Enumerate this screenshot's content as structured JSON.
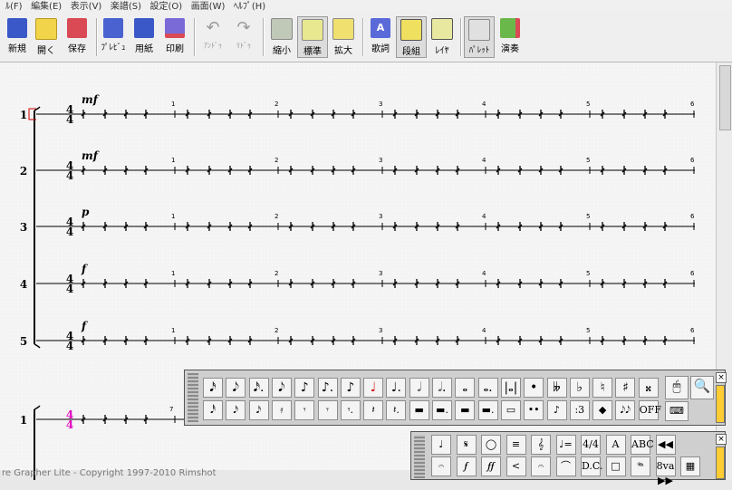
{
  "menu": [
    "ﾙ(F)",
    "編集(E)",
    "表示(V)",
    "楽譜(S)",
    "設定(O)",
    "画面(W)",
    "ﾍﾙﾌﾟ(H)"
  ],
  "toolbar": {
    "new": "新規",
    "open": "開く",
    "save": "保存",
    "preview": "ﾌﾟﾚﾋﾞｭ",
    "paper": "用紙",
    "print": "印刷",
    "undo": "ｱﾝﾄﾞｩ",
    "redo": "ﾘﾄﾞｩ",
    "zoom_out": "縮小",
    "zoom_std": "標準",
    "zoom_in": "拡大",
    "lyrics": "歌詞",
    "columns": "段組",
    "layer": "ﾚｲﾔ",
    "palette": "ﾊﾟﾚｯﾄ",
    "play": "演奏"
  },
  "score": {
    "staves": [
      {
        "number": "1",
        "dynamic": "mf"
      },
      {
        "number": "2",
        "dynamic": "mf"
      },
      {
        "number": "3",
        "dynamic": "p"
      },
      {
        "number": "4",
        "dynamic": "f"
      },
      {
        "number": "5",
        "dynamic": "f"
      }
    ],
    "time_signature": {
      "top": "4",
      "bottom": "4"
    },
    "measure_numbers": [
      "1",
      "2",
      "3",
      "4",
      "5",
      "6"
    ],
    "second_system": {
      "number": "1",
      "measure_number": "7",
      "time_color": "#e000c0"
    }
  },
  "palette_notes": {
    "row1": [
      "𝅘𝅥𝅯",
      "𝅘𝅥𝅮",
      "𝅘𝅥𝅯.",
      "𝅘𝅥𝅮",
      "♪",
      "♪.",
      "♪",
      "♩",
      "♩.",
      "𝅗𝅥",
      "𝅗𝅥.",
      "𝅝",
      "𝅝.",
      "|𝅝|",
      "•",
      "𝄫",
      "♭",
      "♮",
      "♯",
      "𝄪"
    ],
    "row2": [
      "𝅘𝅥𝅰",
      "𝅘𝅥𝅯",
      "𝅘𝅥𝅯",
      "𝄿",
      "𝄾",
      "𝄾",
      "𝄾.",
      "𝄽",
      "𝄽.",
      "▬",
      "▬.",
      "▬",
      "▬.",
      "▭",
      "••",
      "♪",
      ":3",
      "◆",
      "𝅘𝅥𝅮𝅘𝅥𝅮",
      "OFF"
    ],
    "row2_lettering": {
      "triplet": "3",
      "off": "OFF"
    }
  },
  "palette_tools": {
    "row1": [
      "♩",
      "𝄋",
      "◯",
      "≡",
      "𝄞",
      "♩=",
      "4/4",
      "A",
      "ABC",
      "◀◀ ▶ ▶▶"
    ],
    "row2": [
      "𝄐",
      "𝆑",
      "𝆑𝆑",
      "<",
      "𝄐",
      "⌒",
      "D.C.",
      "□",
      "𝆮",
      "8va",
      "▦"
    ],
    "texts": {
      "abc": "ABC",
      "dc": "D.C.",
      "ottava": "8va"
    }
  },
  "status": "re Grapher Lite - Copyright 1997-2010 Rimshot",
  "colors": {
    "accent_red": "#d10000",
    "staff": "#000000",
    "paper": "#f5f5f5",
    "time_sig_highlight": "#e000c0"
  }
}
